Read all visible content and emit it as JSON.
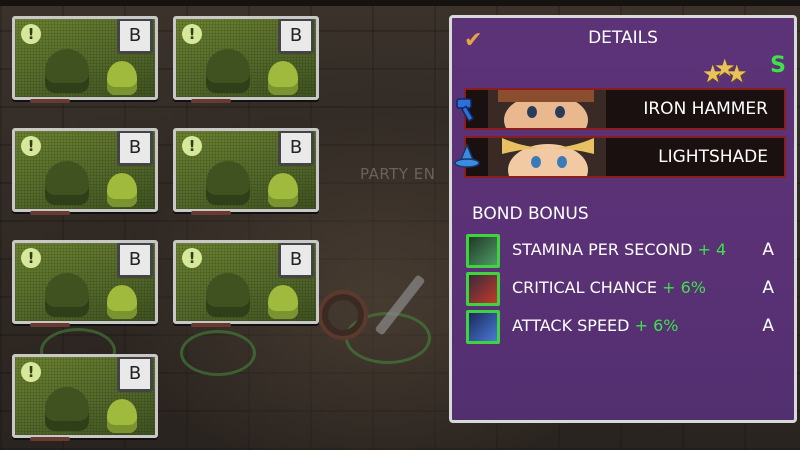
{
  "cards": [
    {
      "alert": "!",
      "grade": "B"
    },
    {
      "alert": "!",
      "grade": "B"
    },
    {
      "alert": "!",
      "grade": "B"
    },
    {
      "alert": "!",
      "grade": "B"
    },
    {
      "alert": "!",
      "grade": "B"
    },
    {
      "alert": "!",
      "grade": "B"
    },
    {
      "alert": "!",
      "grade": "B"
    }
  ],
  "background": {
    "label": "PARTY EN"
  },
  "details": {
    "check": "✔",
    "title": "DETAILS",
    "stars": 3,
    "rank": "S",
    "heroes": [
      {
        "name": "IRON HAMMER",
        "icon": "hammer-icon"
      },
      {
        "name": "LIGHTSHADE",
        "icon": "wizard-hat-icon"
      }
    ],
    "bond_title": "BOND BONUS",
    "bonuses": [
      {
        "label": "STAMINA PER SECOND",
        "value": "+ 4",
        "grade": "A",
        "icon": "wind-swirl-icon"
      },
      {
        "label": "CRITICAL CHANCE",
        "value": "+ 6%",
        "grade": "A",
        "icon": "crit-claw-icon"
      },
      {
        "label": "ATTACK SPEED",
        "value": "+ 6%",
        "grade": "A",
        "icon": "sword-speed-icon"
      }
    ]
  },
  "colors": {
    "panel": "#5a3175",
    "card": "#586b2a",
    "bonus_green": "#3fe04a",
    "hero_border": "#8a1d1d"
  }
}
